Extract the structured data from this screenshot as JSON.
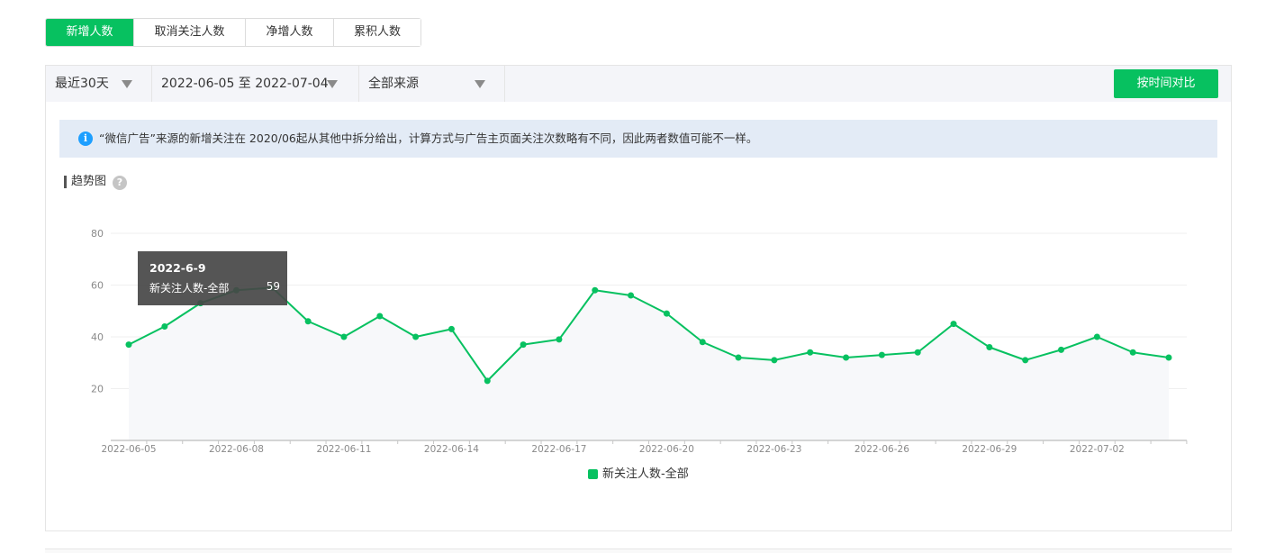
{
  "tabs": [
    {
      "label": "新增人数",
      "active": true
    },
    {
      "label": "取消关注人数",
      "active": false
    },
    {
      "label": "净增人数",
      "active": false
    },
    {
      "label": "累积人数",
      "active": false
    }
  ],
  "filters": {
    "period": "最近30天",
    "date_range": "2022-06-05 至 2022-07-04",
    "source": "全部来源",
    "compare_button": "按时间对比"
  },
  "notice": {
    "icon": "info-icon",
    "text": "“微信广告”来源的新增关注在 2020/06起从其他中拆分给出，计算方式与广告主页面关注次数略有不同，因此两者数值可能不一样。"
  },
  "trend": {
    "title": "趋势图",
    "help_icon": "question-icon"
  },
  "tooltip": {
    "date": "2022-6-9",
    "series": "新关注人数-全部",
    "value": "59"
  },
  "colors": {
    "accent": "#07c160",
    "area": "#f7f8fa",
    "grid": "#efefef"
  },
  "chart_data": {
    "type": "line",
    "ylim": [
      0,
      80
    ],
    "yticks": [
      "80",
      "60",
      "40",
      "20"
    ],
    "ytick_values": [
      80,
      60,
      40,
      20
    ],
    "xtick_labels": [
      "2022-06-05",
      "2022-06-08",
      "2022-06-11",
      "2022-06-14",
      "2022-06-17",
      "2022-06-20",
      "2022-06-23",
      "2022-06-26",
      "2022-06-29",
      "2022-07-02"
    ],
    "x": [
      "2022-06-05",
      "2022-06-06",
      "2022-06-07",
      "2022-06-08",
      "2022-06-09",
      "2022-06-10",
      "2022-06-11",
      "2022-06-12",
      "2022-06-13",
      "2022-06-14",
      "2022-06-15",
      "2022-06-16",
      "2022-06-17",
      "2022-06-18",
      "2022-06-19",
      "2022-06-20",
      "2022-06-21",
      "2022-06-22",
      "2022-06-23",
      "2022-06-24",
      "2022-06-25",
      "2022-06-26",
      "2022-06-27",
      "2022-06-28",
      "2022-06-29",
      "2022-06-30",
      "2022-07-01",
      "2022-07-02",
      "2022-07-03",
      "2022-07-04"
    ],
    "series": [
      {
        "name": "新关注人数-全部",
        "values": [
          37,
          44,
          53,
          58,
          59,
          46,
          40,
          48,
          40,
          43,
          23,
          37,
          39,
          58,
          56,
          49,
          38,
          32,
          31,
          34,
          32,
          33,
          34,
          45,
          36,
          31,
          35,
          40,
          34,
          32
        ]
      }
    ],
    "legend": "bottom-center",
    "area_fill": true
  }
}
